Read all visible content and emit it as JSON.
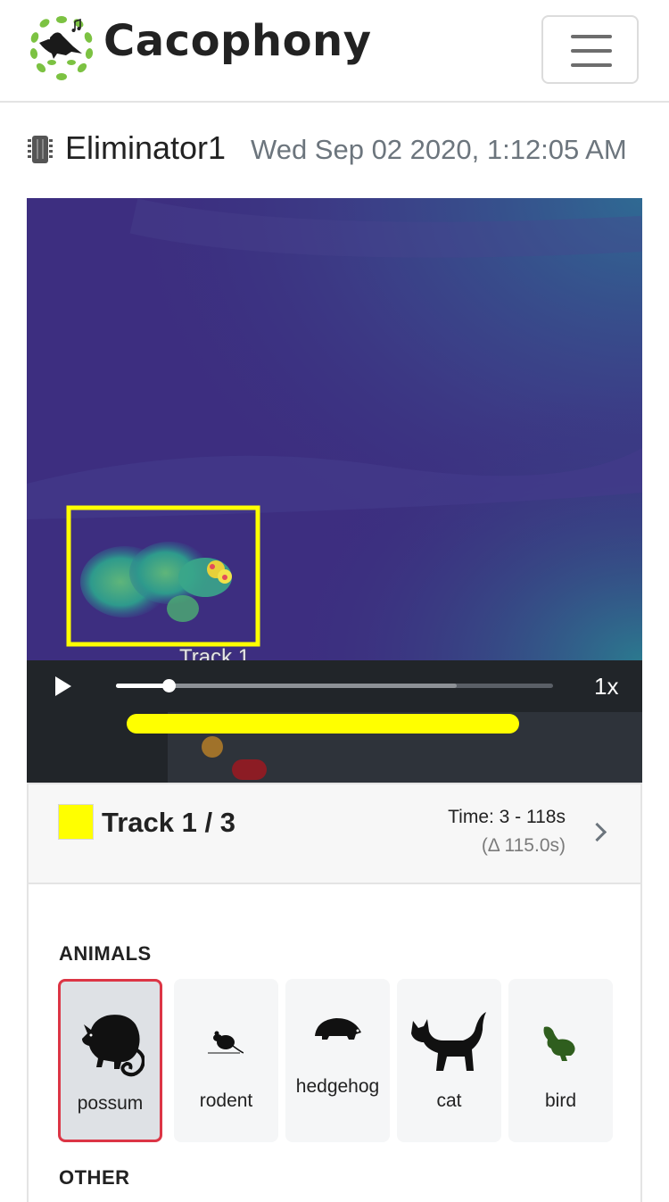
{
  "header": {
    "brand": "Cacophony",
    "menu_icon": "hamburger-icon"
  },
  "recording": {
    "device_icon": "microchip-icon",
    "device_name": "Eliminator1",
    "datetime": "Wed Sep 02 2020, 1:12:05 AM"
  },
  "video": {
    "overlay_label": "Track 1",
    "box_color": "#ffff00"
  },
  "player": {
    "play_icon": "play-icon",
    "progress": 0.12,
    "buffered": 0.78,
    "speed": "1x"
  },
  "timeline": {
    "tracks": [
      {
        "color": "#ffff00"
      },
      {
        "color": "#a0722a"
      },
      {
        "color": "#8c1c24"
      }
    ]
  },
  "track_card": {
    "color": "#ffff00",
    "title": "Track 1 / 3",
    "time": "Time: 3 - 118s",
    "delta": "(Δ 115.0s)",
    "next_icon": "chevron-right-icon"
  },
  "tagging": {
    "animals_heading": "ANIMALS",
    "other_heading": "OTHER",
    "animals": [
      {
        "label": "possum",
        "icon": "possum-icon",
        "selected": true
      },
      {
        "label": "rodent",
        "icon": "rodent-icon",
        "selected": false
      },
      {
        "label": "hedgehog",
        "icon": "hedgehog-icon",
        "selected": false
      },
      {
        "label": "cat",
        "icon": "cat-icon",
        "selected": false
      },
      {
        "label": "bird",
        "icon": "bird-icon",
        "selected": false
      }
    ],
    "selected_color": "#dc3545"
  }
}
